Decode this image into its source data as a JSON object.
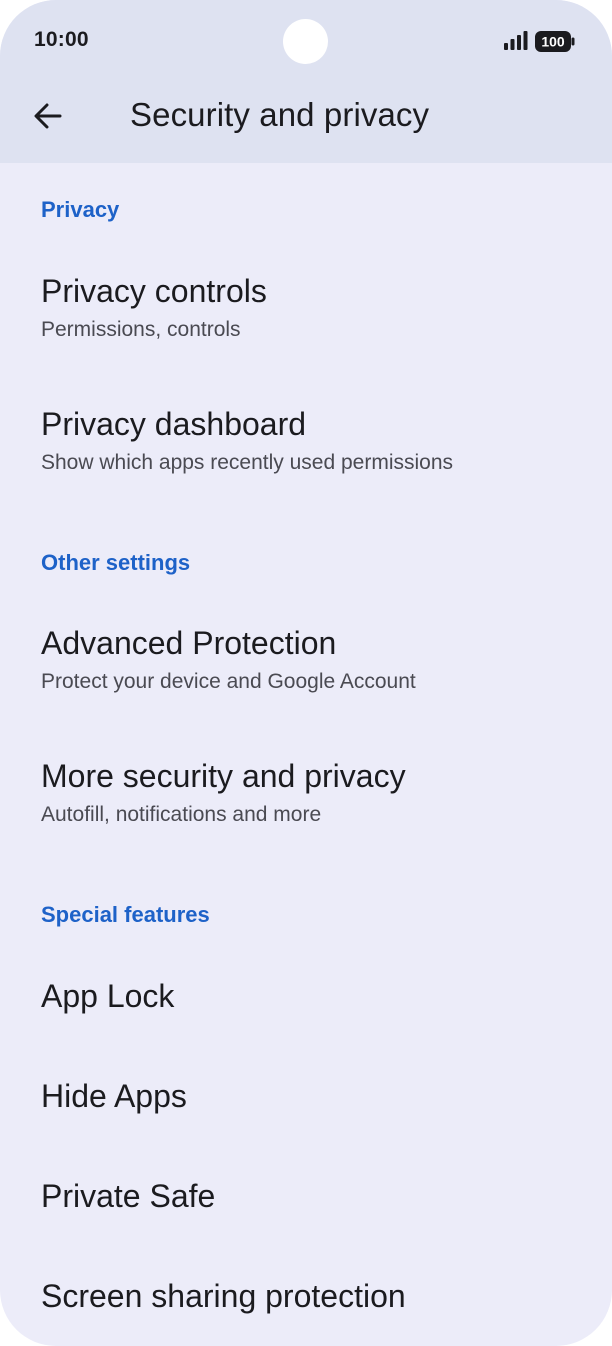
{
  "status_bar": {
    "time": "10:00",
    "battery": "100"
  },
  "header": {
    "title": "Security and privacy",
    "back_icon": "arrow-left-icon"
  },
  "sections": {
    "privacy": {
      "header": "Privacy",
      "items": [
        {
          "title": "Privacy controls",
          "subtitle": "Permissions, controls"
        },
        {
          "title": "Privacy dashboard",
          "subtitle": "Show which apps recently used permissions"
        }
      ]
    },
    "other": {
      "header": "Other settings",
      "items": [
        {
          "title": "Advanced Protection",
          "subtitle": "Protect your device and Google Account"
        },
        {
          "title": "More security and privacy",
          "subtitle": "Autofill, notifications and more"
        }
      ]
    },
    "special": {
      "header": "Special features",
      "items": [
        {
          "title": "App Lock"
        },
        {
          "title": "Hide Apps"
        },
        {
          "title": "Private Safe"
        },
        {
          "title": "Screen sharing protection"
        }
      ]
    }
  },
  "colors": {
    "background": "#ECECF9",
    "topbar": "#DEE2F1",
    "accent": "#1E62C8",
    "text_primary": "#1b1b1f",
    "text_secondary": "#4a4a52"
  }
}
